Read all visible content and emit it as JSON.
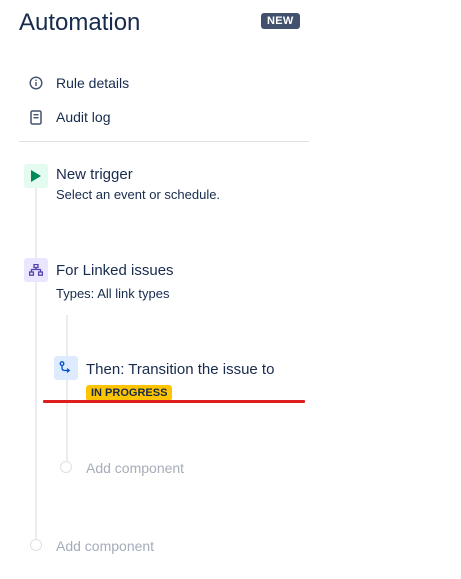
{
  "header": {
    "title": "Automation",
    "badge": "NEW"
  },
  "nav": {
    "rule_details": {
      "label": "Rule details",
      "icon": "info-icon"
    },
    "audit_log": {
      "label": "Audit log",
      "icon": "document-icon"
    }
  },
  "components": {
    "trigger": {
      "icon": "play-icon",
      "title": "New trigger",
      "subtitle": "Select an event or schedule."
    },
    "branch": {
      "icon": "hierarchy-icon",
      "title": "For Linked issues",
      "subtitle": "Types: All link types"
    },
    "action": {
      "icon": "transition-icon",
      "title": "Then: Transition the issue to",
      "status": "IN PROGRESS"
    }
  },
  "add_component_inner": "Add component",
  "add_component_outer": "Add component",
  "colors": {
    "trigger_accent": "#00875a",
    "branch_accent": "#5243aa",
    "action_accent": "#0052cc",
    "status_lozenge": "#ffc400",
    "highlight": "#de1e1e"
  }
}
